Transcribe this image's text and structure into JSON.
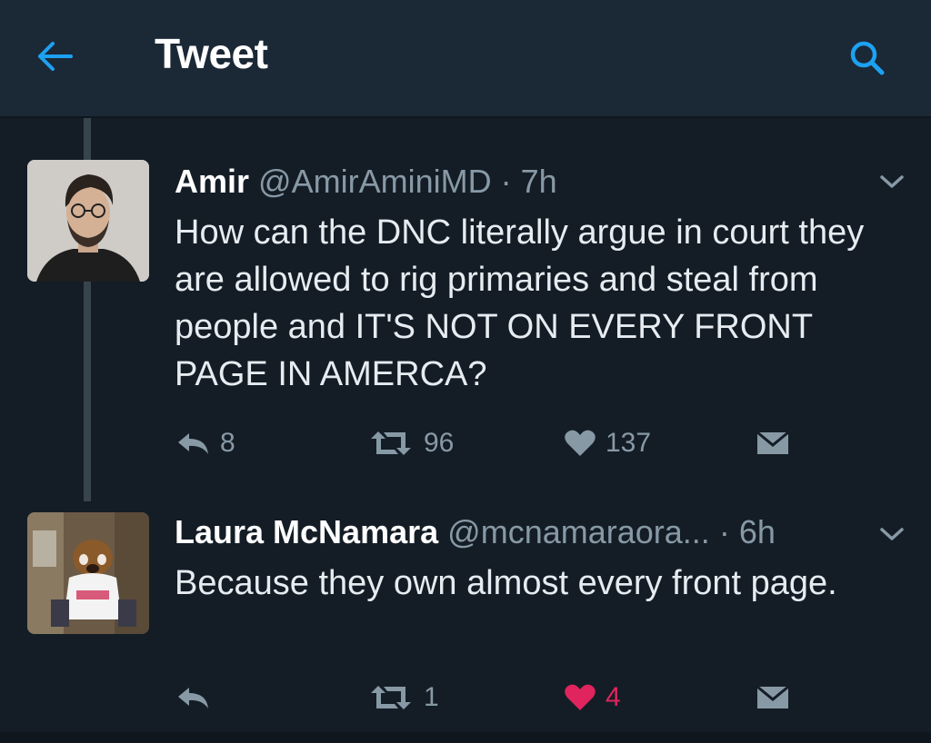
{
  "header": {
    "title": "Tweet",
    "back_icon": "arrow-left-icon",
    "search_icon": "search-icon",
    "accent_color": "#1da1f2"
  },
  "tweets": [
    {
      "name": "Amir",
      "handle": "@AmirAminiMD",
      "separator": "·",
      "time": "7h",
      "text": "How can the DNC literally argue in court they are allowed to rig primaries and steal from people and IT'S NOT ON EVERY FRONT PAGE IN AMERCA?",
      "replies": "8",
      "retweets": "96",
      "likes": "137",
      "liked": false
    },
    {
      "name": "Laura McNamara",
      "handle": "@mcnamaraora...",
      "separator": "·",
      "time": "6h",
      "text": "Because they own almost every front page.",
      "replies": "",
      "retweets": "1",
      "likes": "4",
      "liked": true,
      "like_color": "#e0245e"
    }
  ]
}
